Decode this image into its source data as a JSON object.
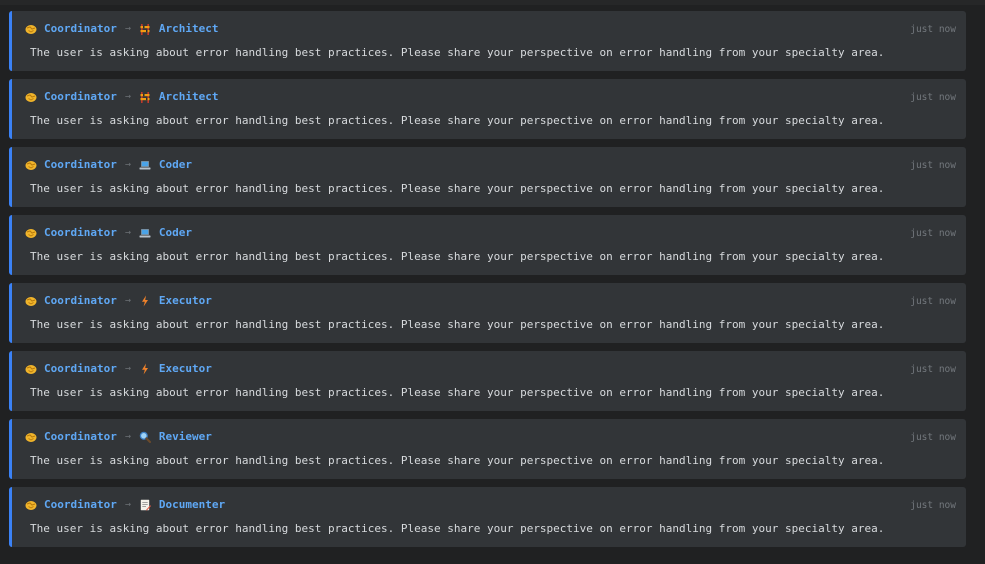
{
  "colors": {
    "accent": "#3b82f6",
    "agent_name": "#5fa8f5",
    "card_bg": "#323538",
    "page_bg": "#202122"
  },
  "messages": [
    {
      "from": "Coordinator",
      "from_icon": "handshake-icon",
      "arrow": "→",
      "to": "Architect",
      "to_icon": "construction-icon",
      "time": "just now",
      "text": "The user is asking about error handling best practices. Please share your perspective on error handling from your specialty area."
    },
    {
      "from": "Coordinator",
      "from_icon": "handshake-icon",
      "arrow": "→",
      "to": "Architect",
      "to_icon": "construction-icon",
      "time": "just now",
      "text": "The user is asking about error handling best practices. Please share your perspective on error handling from your specialty area."
    },
    {
      "from": "Coordinator",
      "from_icon": "handshake-icon",
      "arrow": "→",
      "to": "Coder",
      "to_icon": "laptop-icon",
      "time": "just now",
      "text": "The user is asking about error handling best practices. Please share your perspective on error handling from your specialty area."
    },
    {
      "from": "Coordinator",
      "from_icon": "handshake-icon",
      "arrow": "→",
      "to": "Coder",
      "to_icon": "laptop-icon",
      "time": "just now",
      "text": "The user is asking about error handling best practices. Please share your perspective on error handling from your specialty area."
    },
    {
      "from": "Coordinator",
      "from_icon": "handshake-icon",
      "arrow": "→",
      "to": "Executor",
      "to_icon": "lightning-icon",
      "time": "just now",
      "text": "The user is asking about error handling best practices. Please share your perspective on error handling from your specialty area."
    },
    {
      "from": "Coordinator",
      "from_icon": "handshake-icon",
      "arrow": "→",
      "to": "Executor",
      "to_icon": "lightning-icon",
      "time": "just now",
      "text": "The user is asking about error handling best practices. Please share your perspective on error handling from your specialty area."
    },
    {
      "from": "Coordinator",
      "from_icon": "handshake-icon",
      "arrow": "→",
      "to": "Reviewer",
      "to_icon": "magnifier-icon",
      "time": "just now",
      "text": "The user is asking about error handling best practices. Please share your perspective on error handling from your specialty area."
    },
    {
      "from": "Coordinator",
      "from_icon": "handshake-icon",
      "arrow": "→",
      "to": "Documenter",
      "to_icon": "memo-icon",
      "time": "just now",
      "text": "The user is asking about error handling best practices. Please share your perspective on error handling from your specialty area."
    }
  ]
}
